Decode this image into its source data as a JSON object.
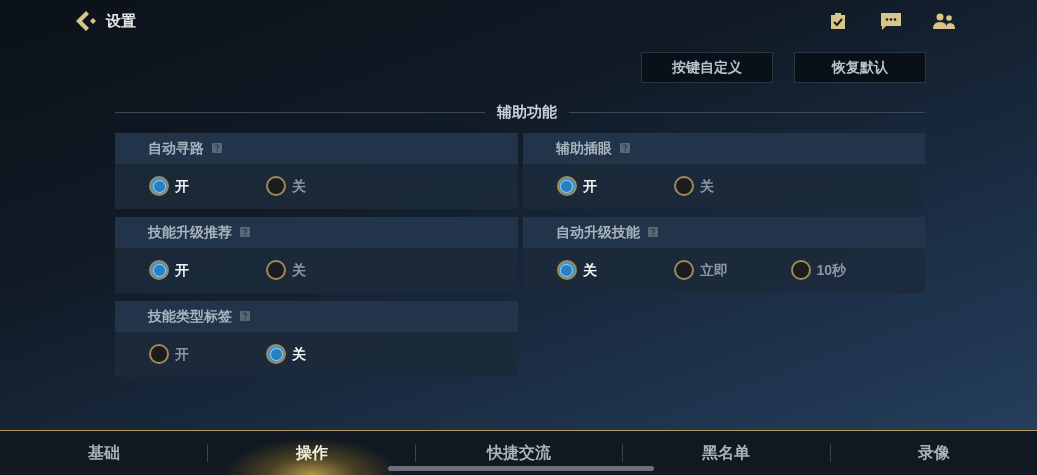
{
  "header": {
    "title": "设置"
  },
  "actions": [
    "按键自定义",
    "恢复默认"
  ],
  "section": {
    "title": "辅助功能"
  },
  "settings": [
    {
      "label": "自动寻路",
      "options": [
        {
          "label": "开",
          "selected": true
        },
        {
          "label": "关",
          "selected": false
        }
      ]
    },
    {
      "label": "辅助插眼",
      "options": [
        {
          "label": "开",
          "selected": true
        },
        {
          "label": "关",
          "selected": false
        }
      ]
    },
    {
      "label": "技能升级推荐",
      "options": [
        {
          "label": "开",
          "selected": true
        },
        {
          "label": "关",
          "selected": false
        }
      ]
    },
    {
      "label": "自动升级技能",
      "options": [
        {
          "label": "关",
          "selected": true
        },
        {
          "label": "立即",
          "selected": false
        },
        {
          "label": "10秒",
          "selected": false
        }
      ]
    },
    {
      "label": "技能类型标签",
      "options": [
        {
          "label": "开",
          "selected": false
        },
        {
          "label": "关",
          "selected": true
        }
      ]
    }
  ],
  "tabs": [
    {
      "label": "基础",
      "selected": false
    },
    {
      "label": "操作",
      "selected": true
    },
    {
      "label": "快捷交流",
      "selected": false
    },
    {
      "label": "黑名单",
      "selected": false
    },
    {
      "label": "录像",
      "selected": false
    }
  ]
}
